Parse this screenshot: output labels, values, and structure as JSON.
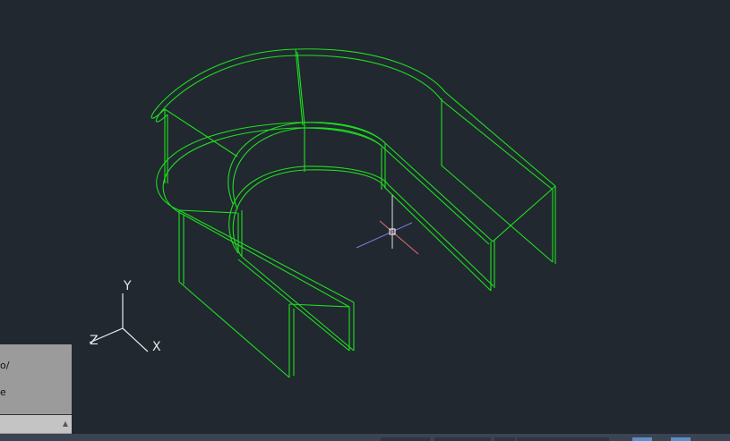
{
  "command_history": [
    "o/",
    "e"
  ],
  "command_input": {
    "value": "",
    "arrow_icon": "caret-up"
  },
  "ucs": {
    "x_label": "X",
    "y_label": "Y",
    "z_label": "Z"
  },
  "colors": {
    "wireframe": "#22dd22",
    "background": "#212830"
  }
}
